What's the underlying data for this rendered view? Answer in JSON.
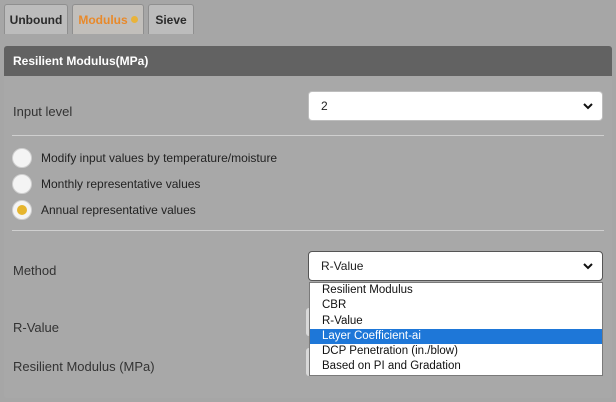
{
  "tabs": [
    {
      "label": "Unbound"
    },
    {
      "label": "Modulus"
    },
    {
      "label": "Sieve"
    }
  ],
  "panel": {
    "title": "Resilient Modulus(MPa)"
  },
  "input_level": {
    "label": "Input level",
    "value": "2"
  },
  "radios": [
    {
      "label": "Modify input values by temperature/moisture",
      "checked": false
    },
    {
      "label": "Monthly representative values",
      "checked": false
    },
    {
      "label": "Annual representative values",
      "checked": true
    }
  ],
  "method": {
    "label": "Method",
    "value": "R-Value",
    "options": [
      "Resilient Modulus",
      "CBR",
      "R-Value",
      "Layer Coefficient-ai",
      "DCP Penetration (in./blow)",
      "Based on PI and Gradation"
    ],
    "highlighted": "Layer Coefficient-ai"
  },
  "rvalue": {
    "label": "R-Value"
  },
  "resilient_modulus": {
    "label": "Resilient Modulus (MPa)"
  },
  "colors": {
    "active_tab": "#e8892a",
    "radio_checked": "#e6b52e",
    "highlight": "#1e77d8",
    "header": "#626262"
  }
}
